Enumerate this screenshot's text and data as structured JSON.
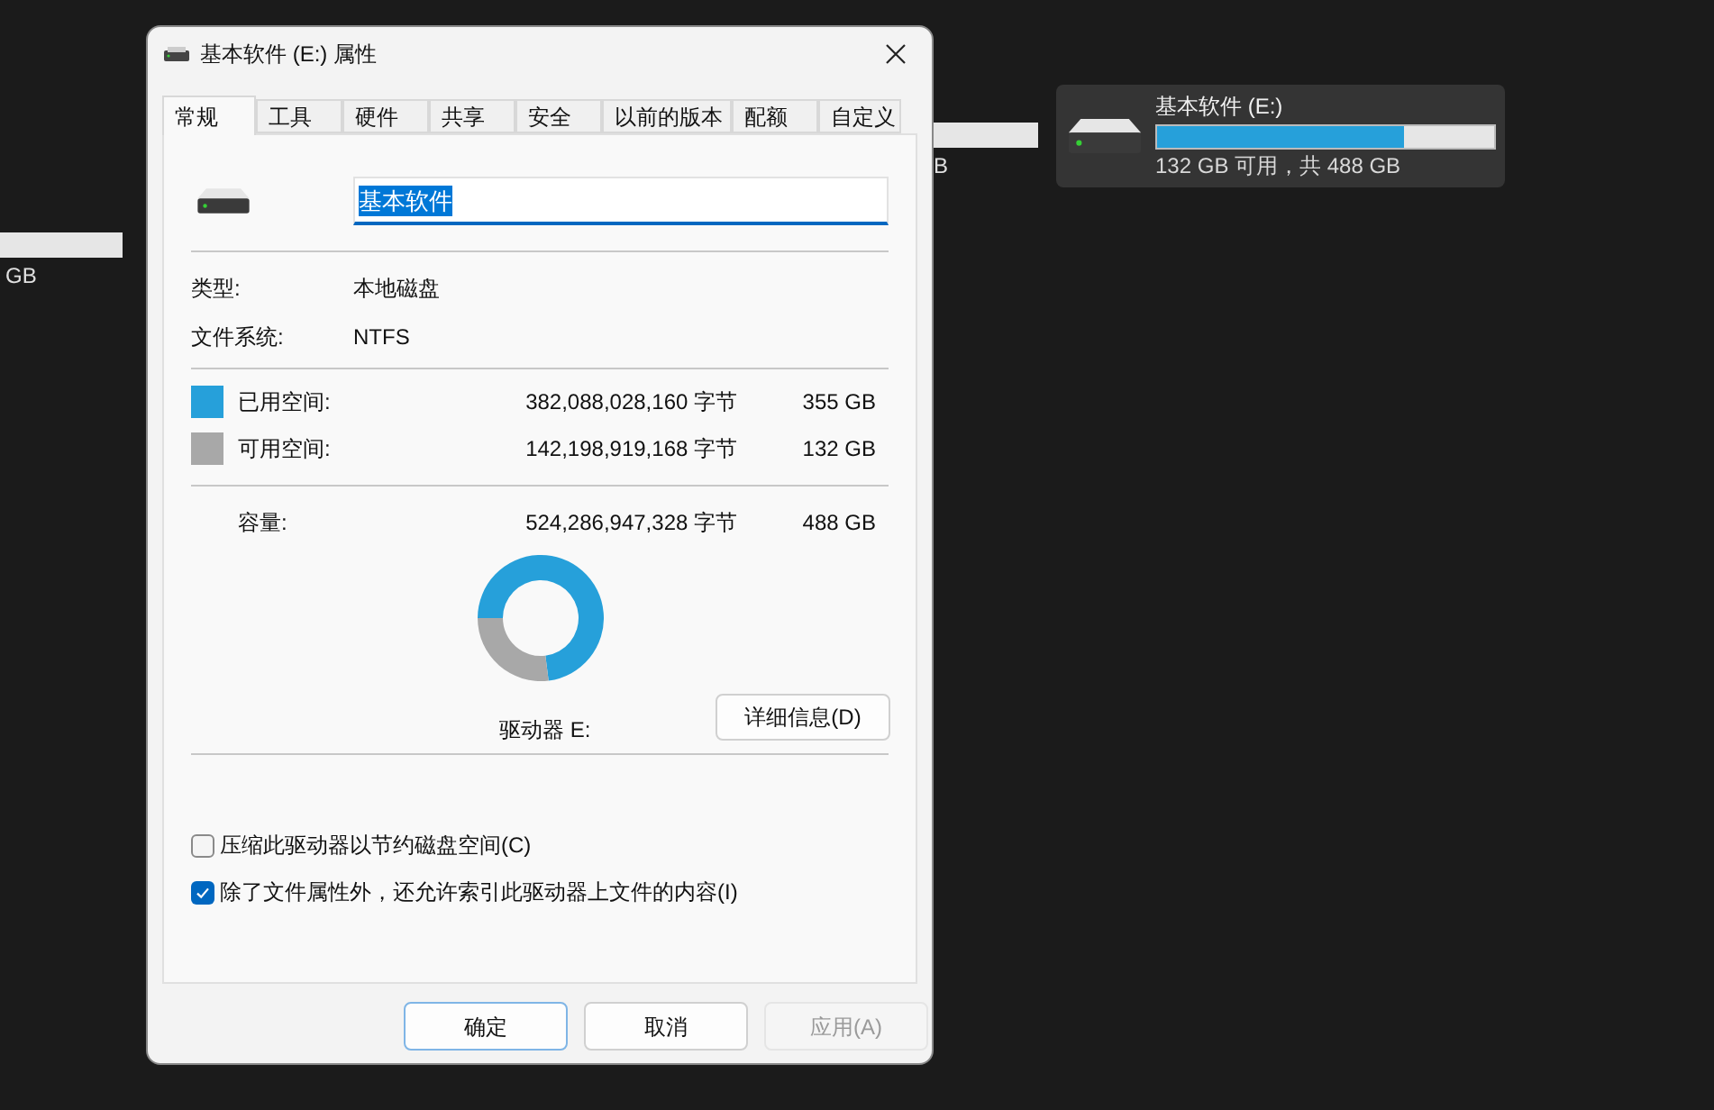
{
  "background": {
    "partial_tiles": [
      {
        "caption": "B"
      },
      {
        "caption": "GB"
      }
    ],
    "drive_tile": {
      "name": "基本软件 (E:)",
      "level": 0.73,
      "caption": "132 GB 可用，共 488 GB",
      "selected": true
    }
  },
  "dialog": {
    "title": "基本软件 (E:) 属性",
    "tabs": [
      {
        "label": "常规",
        "selected": true
      },
      {
        "label": "工具",
        "selected": false
      },
      {
        "label": "硬件",
        "selected": false
      },
      {
        "label": "共享",
        "selected": false
      },
      {
        "label": "安全",
        "selected": false
      },
      {
        "label": "以前的版本",
        "selected": false
      },
      {
        "label": "配额",
        "selected": false
      },
      {
        "label": "自定义",
        "selected": false
      }
    ],
    "name_field": {
      "value": "基本软件",
      "text_selected": true
    },
    "info": [
      {
        "label": "类型:",
        "value": "本地磁盘"
      },
      {
        "label": "文件系统:",
        "value": "NTFS"
      }
    ],
    "space": [
      {
        "label": "已用空间:",
        "bytes": "382,088,028,160 字节",
        "size": "355 GB",
        "color": "#26a0da"
      },
      {
        "label": "可用空间:",
        "bytes": "142,198,919,168 字节",
        "size": "132 GB",
        "color": "#a8a8a8"
      }
    ],
    "capacity": {
      "label": "容量:",
      "bytes": "524,286,947,328 字节",
      "size": "488 GB"
    },
    "usage_donut": {
      "chart_data": {
        "type": "donut",
        "values": [
          73,
          27
        ]
      }
    },
    "drive_label": "驱动器 E:",
    "details_button": "详细信息(D)",
    "checkboxes": [
      {
        "label": "压缩此驱动器以节约磁盘空间(C)",
        "checked": false
      },
      {
        "label": "除了文件属性外，还允许索引此驱动器上文件的内容(I)",
        "checked": true
      }
    ],
    "buttons": [
      {
        "label": "确定",
        "kind": "default",
        "disabled": false
      },
      {
        "label": "取消",
        "kind": "normal",
        "disabled": false
      },
      {
        "label": "应用(A)",
        "kind": "normal",
        "disabled": true
      }
    ]
  }
}
